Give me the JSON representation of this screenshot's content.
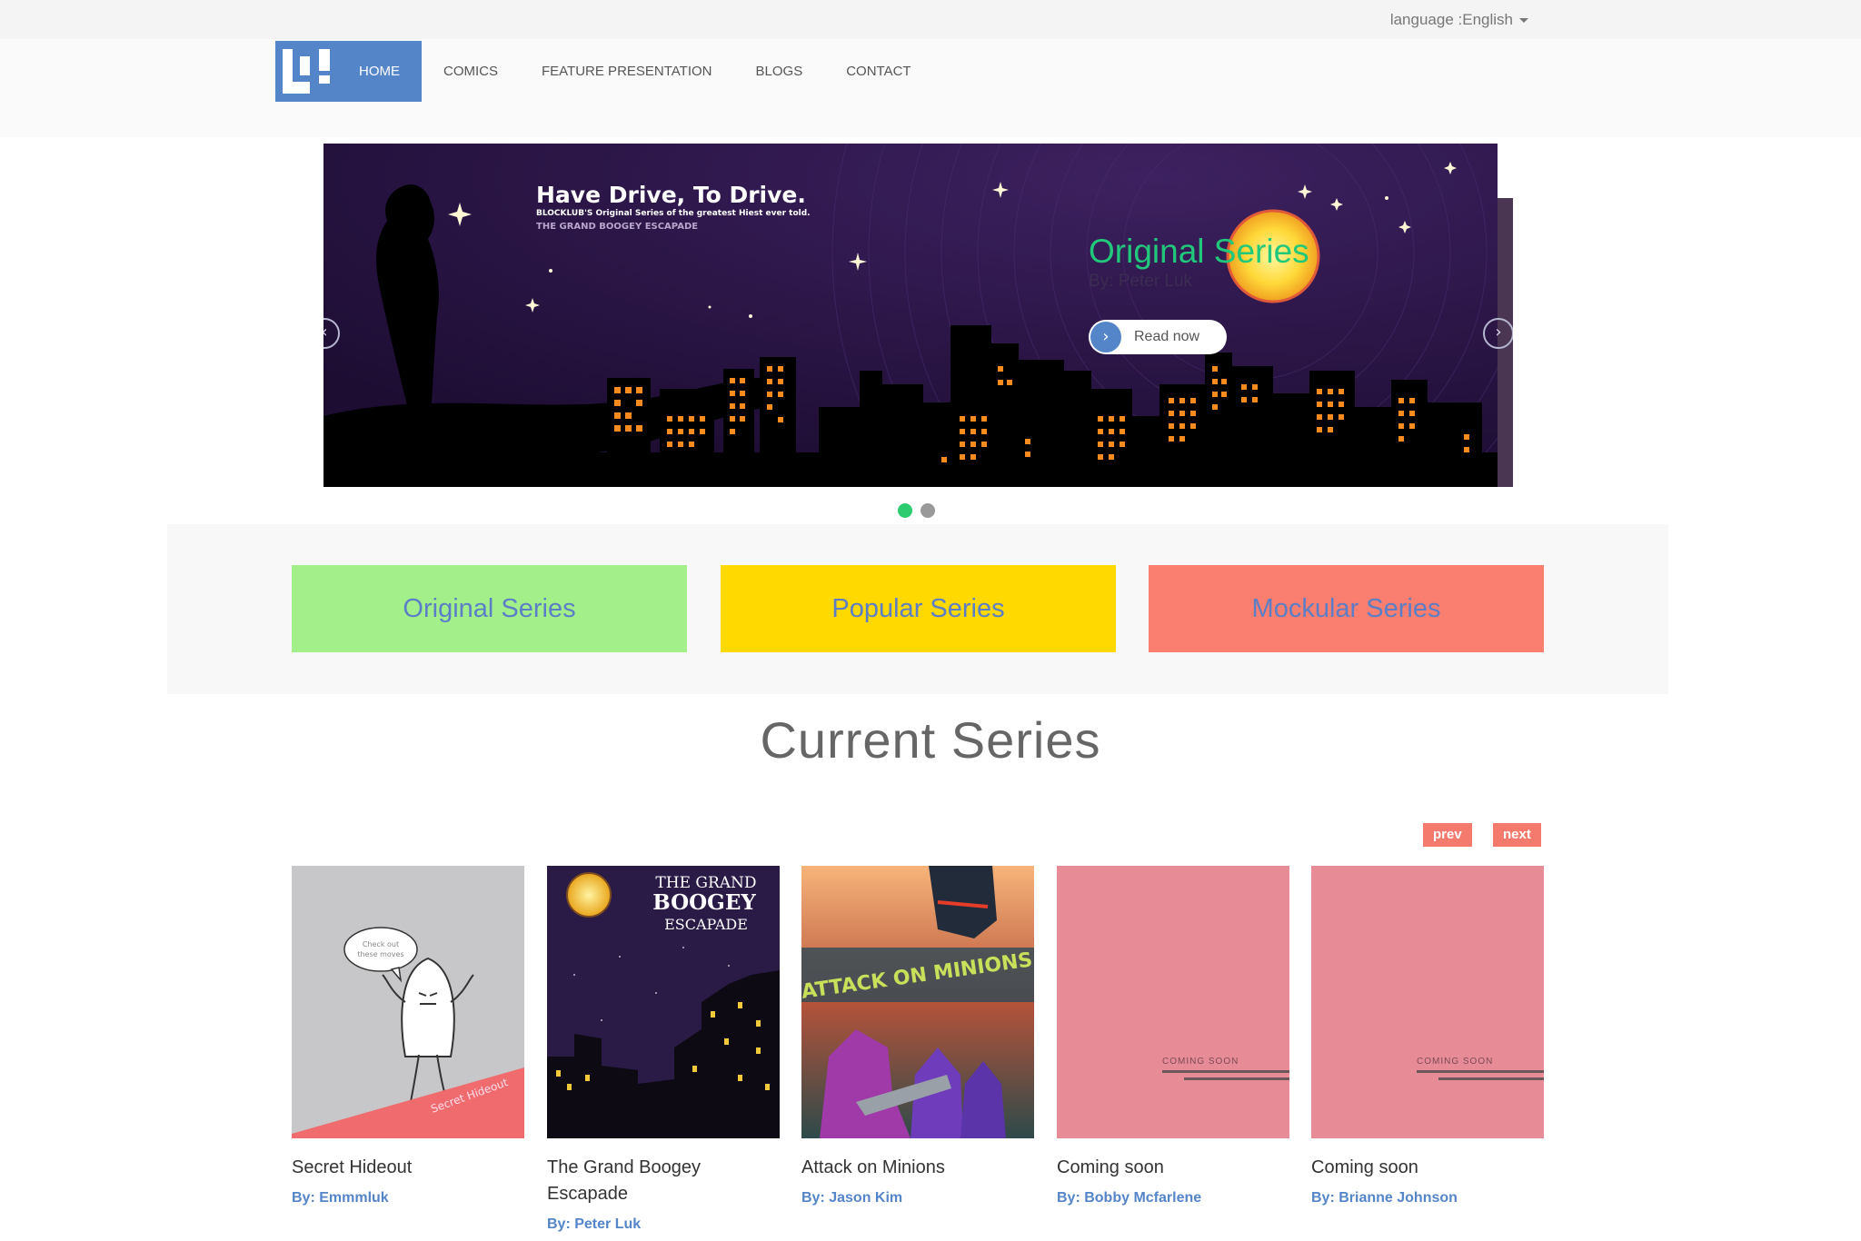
{
  "language": {
    "label": "language :English"
  },
  "nav": {
    "items": [
      {
        "label": "HOME"
      },
      {
        "label": "COMICS"
      },
      {
        "label": "FEATURE PRESENTATION"
      },
      {
        "label": "BLOGS"
      },
      {
        "label": "CONTACT"
      }
    ]
  },
  "hero": {
    "banner_title": "Have Drive, To Drive.",
    "banner_subtitle": "BLOCKLUB'S Original Series of the greatest Hiest ever told.",
    "banner_series": "THE GRAND BOOGEY ESCAPADE",
    "slide_title": "Original Series",
    "slide_author": "By: Peter Luk",
    "read_button": "Read now",
    "prev_icon": "‹",
    "next_icon": "›",
    "read_icon": "›",
    "active_slide": 1,
    "slide_count": 2
  },
  "categories": [
    {
      "label": "Original Series",
      "color": "#a3f08b"
    },
    {
      "label": "Popular Series",
      "color": "#ffd900"
    },
    {
      "label": "Mockular Series",
      "color": "#fa7f70"
    }
  ],
  "current_series": {
    "heading": "Current Series",
    "prev": "prev",
    "next": "next",
    "books": [
      {
        "title": "Secret Hideout",
        "author": "By: Emmmluk",
        "bubble": "Check out these moves",
        "banner": "Secret Hideout"
      },
      {
        "title": "The Grand Boogey Escapade",
        "author": "By: Peter Luk",
        "cover_line1": "THE GRAND",
        "cover_line2": "BOOGEY",
        "cover_line3": "ESCAPADE"
      },
      {
        "title": "Attack on Minions",
        "author": "By: Jason Kim",
        "cover_text": "ATTACK ON MINIONS"
      },
      {
        "title": "Coming soon",
        "author": "By: Bobby Mcfarlene",
        "cover_text": "COMING SOON"
      },
      {
        "title": "Coming soon",
        "author": "By: Brianne Johnson",
        "cover_text": "COMING SOON"
      }
    ]
  },
  "colors": {
    "accent": "#5585c9",
    "green": "#2ecc71",
    "coral": "#f57a6e"
  }
}
